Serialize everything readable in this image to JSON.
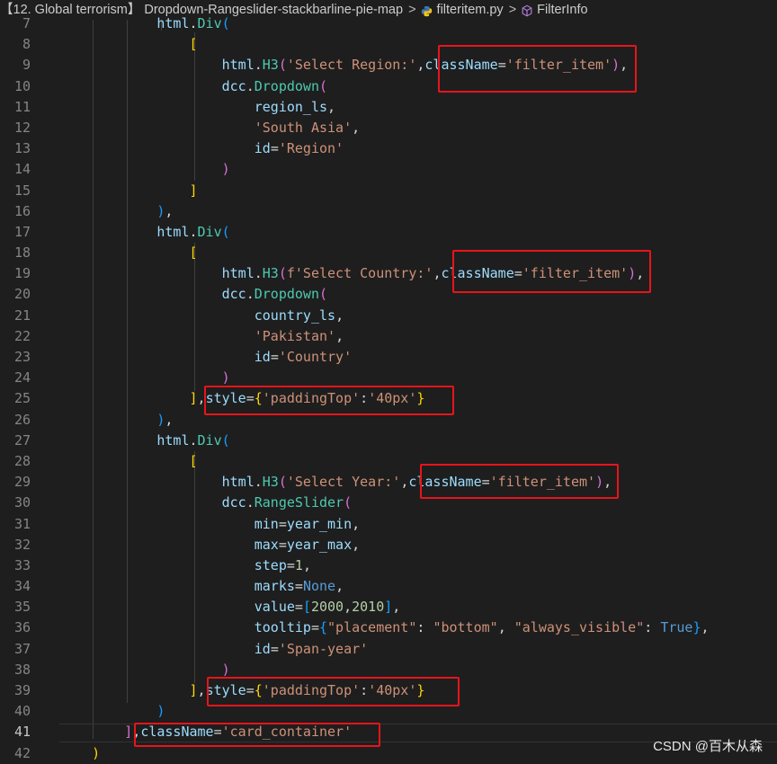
{
  "breadcrumb": {
    "folder": "【12. Global terrorism】 Dropdown-Rangeslider-stackbarline-pie-map",
    "file": "filteritem.py",
    "symbol": "FilterInfo"
  },
  "editor": {
    "active_line": "41",
    "lines": [
      {
        "n": "7",
        "tokens": [
          [
            "            ",
            "p"
          ],
          [
            "html",
            "var"
          ],
          [
            ".",
            "p"
          ],
          [
            "Div",
            "cls"
          ],
          [
            "(",
            "b3"
          ]
        ]
      },
      {
        "n": "8",
        "tokens": [
          [
            "                ",
            "p"
          ],
          [
            "[",
            "b1"
          ]
        ]
      },
      {
        "n": "9",
        "tokens": [
          [
            "                    ",
            "p"
          ],
          [
            "html",
            "var"
          ],
          [
            ".",
            "p"
          ],
          [
            "H3",
            "cls"
          ],
          [
            "(",
            "b2"
          ],
          [
            "'Select Region:'",
            "str"
          ],
          [
            ",",
            "p"
          ],
          [
            "className",
            "var"
          ],
          [
            "=",
            "p"
          ],
          [
            "'filter_item'",
            "str"
          ],
          [
            ")",
            "b2"
          ],
          [
            ",",
            "p"
          ]
        ]
      },
      {
        "n": "10",
        "tokens": [
          [
            "                    ",
            "p"
          ],
          [
            "dcc",
            "var"
          ],
          [
            ".",
            "p"
          ],
          [
            "Dropdown",
            "cls"
          ],
          [
            "(",
            "b2"
          ]
        ]
      },
      {
        "n": "11",
        "tokens": [
          [
            "                        ",
            "p"
          ],
          [
            "region_ls",
            "var"
          ],
          [
            ",",
            "p"
          ]
        ]
      },
      {
        "n": "12",
        "tokens": [
          [
            "                        ",
            "p"
          ],
          [
            "'South Asia'",
            "str"
          ],
          [
            ",",
            "p"
          ]
        ]
      },
      {
        "n": "13",
        "tokens": [
          [
            "                        ",
            "p"
          ],
          [
            "id",
            "var"
          ],
          [
            "=",
            "p"
          ],
          [
            "'Region'",
            "str"
          ]
        ]
      },
      {
        "n": "14",
        "tokens": [
          [
            "                    ",
            "p"
          ],
          [
            ")",
            "b2"
          ]
        ]
      },
      {
        "n": "15",
        "tokens": [
          [
            "                ",
            "p"
          ],
          [
            "]",
            "b1"
          ]
        ]
      },
      {
        "n": "16",
        "tokens": [
          [
            "            ",
            "p"
          ],
          [
            ")",
            "b3"
          ],
          [
            ",",
            "p"
          ]
        ]
      },
      {
        "n": "17",
        "tokens": [
          [
            "            ",
            "p"
          ],
          [
            "html",
            "var"
          ],
          [
            ".",
            "p"
          ],
          [
            "Div",
            "cls"
          ],
          [
            "(",
            "b3"
          ]
        ]
      },
      {
        "n": "18",
        "tokens": [
          [
            "                ",
            "p"
          ],
          [
            "[",
            "b1"
          ]
        ]
      },
      {
        "n": "19",
        "tokens": [
          [
            "                    ",
            "p"
          ],
          [
            "html",
            "var"
          ],
          [
            ".",
            "p"
          ],
          [
            "H3",
            "cls"
          ],
          [
            "(",
            "b2"
          ],
          [
            "f'Select Country:'",
            "str"
          ],
          [
            ",",
            "p"
          ],
          [
            "className",
            "var"
          ],
          [
            "=",
            "p"
          ],
          [
            "'filter_item'",
            "str"
          ],
          [
            ")",
            "b2"
          ],
          [
            ",",
            "p"
          ]
        ]
      },
      {
        "n": "20",
        "tokens": [
          [
            "                    ",
            "p"
          ],
          [
            "dcc",
            "var"
          ],
          [
            ".",
            "p"
          ],
          [
            "Dropdown",
            "cls"
          ],
          [
            "(",
            "b2"
          ]
        ]
      },
      {
        "n": "21",
        "tokens": [
          [
            "                        ",
            "p"
          ],
          [
            "country_ls",
            "var"
          ],
          [
            ",",
            "p"
          ]
        ]
      },
      {
        "n": "22",
        "tokens": [
          [
            "                        ",
            "p"
          ],
          [
            "'Pakistan'",
            "str"
          ],
          [
            ",",
            "p"
          ]
        ]
      },
      {
        "n": "23",
        "tokens": [
          [
            "                        ",
            "p"
          ],
          [
            "id",
            "var"
          ],
          [
            "=",
            "p"
          ],
          [
            "'Country'",
            "str"
          ]
        ]
      },
      {
        "n": "24",
        "tokens": [
          [
            "                    ",
            "p"
          ],
          [
            ")",
            "b2"
          ]
        ]
      },
      {
        "n": "25",
        "tokens": [
          [
            "                ",
            "p"
          ],
          [
            "]",
            "b1"
          ],
          [
            ",",
            "p"
          ],
          [
            "style",
            "var"
          ],
          [
            "=",
            "p"
          ],
          [
            "{",
            "b1"
          ],
          [
            "'paddingTop'",
            "str"
          ],
          [
            ":",
            "p"
          ],
          [
            "'40px'",
            "str"
          ],
          [
            "}",
            "b1"
          ]
        ]
      },
      {
        "n": "26",
        "tokens": [
          [
            "            ",
            "p"
          ],
          [
            ")",
            "b3"
          ],
          [
            ",",
            "p"
          ]
        ]
      },
      {
        "n": "27",
        "tokens": [
          [
            "            ",
            "p"
          ],
          [
            "html",
            "var"
          ],
          [
            ".",
            "p"
          ],
          [
            "Div",
            "cls"
          ],
          [
            "(",
            "b3"
          ]
        ]
      },
      {
        "n": "28",
        "tokens": [
          [
            "                ",
            "p"
          ],
          [
            "[",
            "b1"
          ]
        ]
      },
      {
        "n": "29",
        "tokens": [
          [
            "                    ",
            "p"
          ],
          [
            "html",
            "var"
          ],
          [
            ".",
            "p"
          ],
          [
            "H3",
            "cls"
          ],
          [
            "(",
            "b2"
          ],
          [
            "'Select Year:'",
            "str"
          ],
          [
            ",",
            "p"
          ],
          [
            "className",
            "var"
          ],
          [
            "=",
            "p"
          ],
          [
            "'filter_item'",
            "str"
          ],
          [
            ")",
            "b2"
          ],
          [
            ",",
            "p"
          ]
        ]
      },
      {
        "n": "30",
        "tokens": [
          [
            "                    ",
            "p"
          ],
          [
            "dcc",
            "var"
          ],
          [
            ".",
            "p"
          ],
          [
            "RangeSlider",
            "cls"
          ],
          [
            "(",
            "b2"
          ]
        ]
      },
      {
        "n": "31",
        "tokens": [
          [
            "                        ",
            "p"
          ],
          [
            "min",
            "var"
          ],
          [
            "=",
            "p"
          ],
          [
            "year_min",
            "var"
          ],
          [
            ",",
            "p"
          ]
        ]
      },
      {
        "n": "32",
        "tokens": [
          [
            "                        ",
            "p"
          ],
          [
            "max",
            "var"
          ],
          [
            "=",
            "p"
          ],
          [
            "year_max",
            "var"
          ],
          [
            ",",
            "p"
          ]
        ]
      },
      {
        "n": "33",
        "tokens": [
          [
            "                        ",
            "p"
          ],
          [
            "step",
            "var"
          ],
          [
            "=",
            "p"
          ],
          [
            "1",
            "num"
          ],
          [
            ",",
            "p"
          ]
        ]
      },
      {
        "n": "34",
        "tokens": [
          [
            "                        ",
            "p"
          ],
          [
            "marks",
            "var"
          ],
          [
            "=",
            "p"
          ],
          [
            "None",
            "kw"
          ],
          [
            ",",
            "p"
          ]
        ]
      },
      {
        "n": "35",
        "tokens": [
          [
            "                        ",
            "p"
          ],
          [
            "value",
            "var"
          ],
          [
            "=",
            "p"
          ],
          [
            "[",
            "b3"
          ],
          [
            "2000",
            "num"
          ],
          [
            ",",
            "p"
          ],
          [
            "2010",
            "num"
          ],
          [
            "]",
            "b3"
          ],
          [
            ",",
            "p"
          ]
        ]
      },
      {
        "n": "36",
        "tokens": [
          [
            "                        ",
            "p"
          ],
          [
            "tooltip",
            "var"
          ],
          [
            "=",
            "p"
          ],
          [
            "{",
            "b3"
          ],
          [
            "\"placement\"",
            "str"
          ],
          [
            ": ",
            "p"
          ],
          [
            "\"bottom\"",
            "str"
          ],
          [
            ", ",
            "p"
          ],
          [
            "\"always_visible\"",
            "str"
          ],
          [
            ": ",
            "p"
          ],
          [
            "True",
            "kw"
          ],
          [
            "}",
            "b3"
          ],
          [
            ",",
            "p"
          ]
        ]
      },
      {
        "n": "37",
        "tokens": [
          [
            "                        ",
            "p"
          ],
          [
            "id",
            "var"
          ],
          [
            "=",
            "p"
          ],
          [
            "'Span-year'",
            "str"
          ]
        ]
      },
      {
        "n": "38",
        "tokens": [
          [
            "                    ",
            "p"
          ],
          [
            ")",
            "b2"
          ]
        ]
      },
      {
        "n": "39",
        "tokens": [
          [
            "                ",
            "p"
          ],
          [
            "]",
            "b1"
          ],
          [
            ",",
            "p"
          ],
          [
            "style",
            "var"
          ],
          [
            "=",
            "p"
          ],
          [
            "{",
            "b1"
          ],
          [
            "'paddingTop'",
            "str"
          ],
          [
            ":",
            "p"
          ],
          [
            "'40px'",
            "str"
          ],
          [
            "}",
            "b1"
          ]
        ]
      },
      {
        "n": "40",
        "tokens": [
          [
            "            ",
            "p"
          ],
          [
            ")",
            "b3"
          ]
        ]
      },
      {
        "n": "41",
        "tokens": [
          [
            "        ",
            "p"
          ],
          [
            "]",
            "b2"
          ],
          [
            ",",
            "p"
          ],
          [
            "className",
            "var"
          ],
          [
            "=",
            "p"
          ],
          [
            "'card_container'",
            "str"
          ]
        ]
      },
      {
        "n": "42",
        "tokens": [
          [
            "    ",
            "p"
          ],
          [
            ")",
            "b1"
          ]
        ]
      }
    ]
  },
  "highlight_color": "#e8141b",
  "watermark": "CSDN @百木从森"
}
